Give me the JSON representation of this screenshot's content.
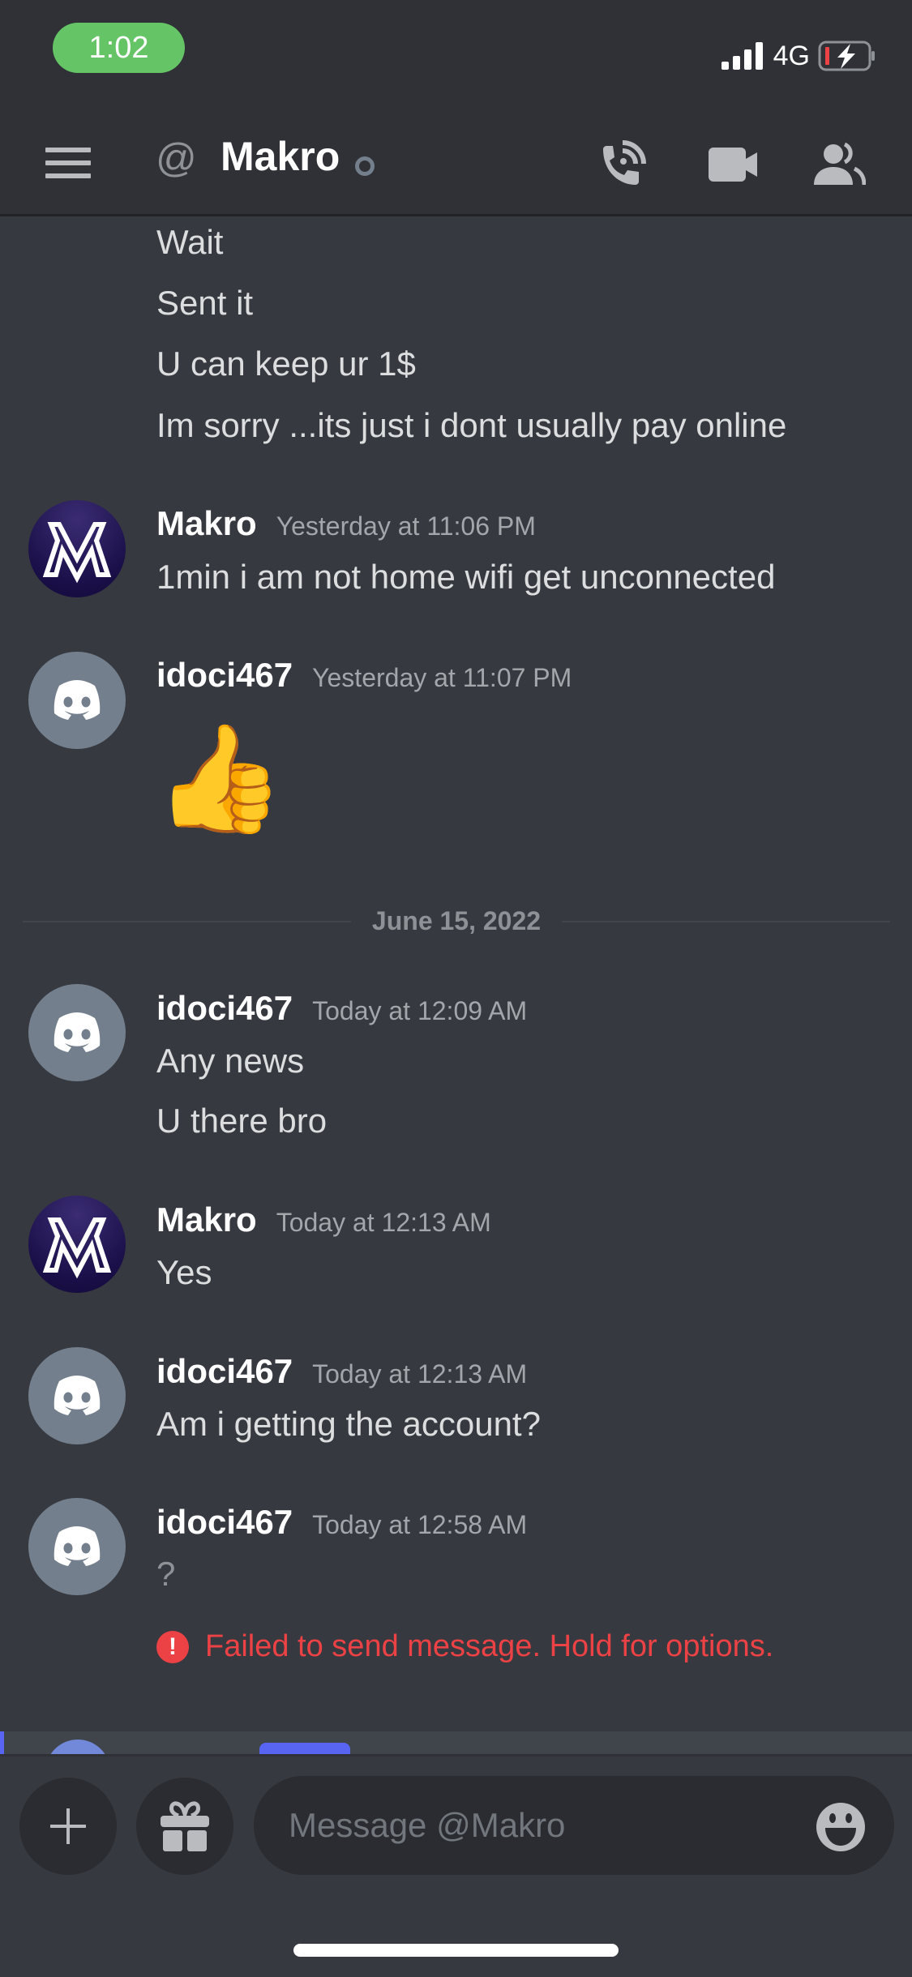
{
  "status_bar": {
    "time": "1:02",
    "network": "4G",
    "time_pill_color": "#65c466",
    "battery_state": "charging-low"
  },
  "header": {
    "channel_prefix": "@",
    "title": "Makro",
    "presence": "offline",
    "icons": [
      "menu-icon",
      "voice-call-icon",
      "video-call-icon",
      "members-icon"
    ]
  },
  "messages": [
    {
      "type": "continuation",
      "lines": [
        "Wait",
        "Sent it",
        "U can keep ur 1$",
        "Im sorry ...its just i dont usually pay online"
      ]
    },
    {
      "author": "Makro",
      "avatar": "makro-logo",
      "timestamp": "Yesterday at 11:06 PM",
      "lines": [
        "1min i am not home wifi get unconnected"
      ]
    },
    {
      "author": "idoci467",
      "avatar": "discord-default",
      "timestamp": "Yesterday at 11:07 PM",
      "lines": [
        "👍"
      ]
    },
    {
      "author": "idoci467",
      "avatar": "discord-default",
      "timestamp": "Today at 12:09 AM",
      "lines": [
        "Any news",
        "U there bro"
      ]
    },
    {
      "author": "Makro",
      "avatar": "makro-logo",
      "timestamp": "Today at 12:13 AM",
      "lines": [
        "Yes"
      ]
    },
    {
      "author": "idoci467",
      "avatar": "discord-default",
      "timestamp": "Today at 12:13 AM",
      "lines": [
        "Am i getting the account?"
      ]
    },
    {
      "author": "idoci467",
      "avatar": "discord-default",
      "timestamp": "Today at 12:58 AM",
      "lines": [
        "?"
      ],
      "failed": true
    }
  ],
  "date_divider": "June 15, 2022",
  "failed_notice": "Failed to send message. Hold for options.",
  "input": {
    "placeholder": "Message @Makro",
    "value": ""
  },
  "colors": {
    "background": "#36393f",
    "header": "#2f3136",
    "error": "#ed4245",
    "blurple": "#5865f2",
    "makro_avatar": "#1a0f48",
    "default_avatar": "#747f8d"
  }
}
